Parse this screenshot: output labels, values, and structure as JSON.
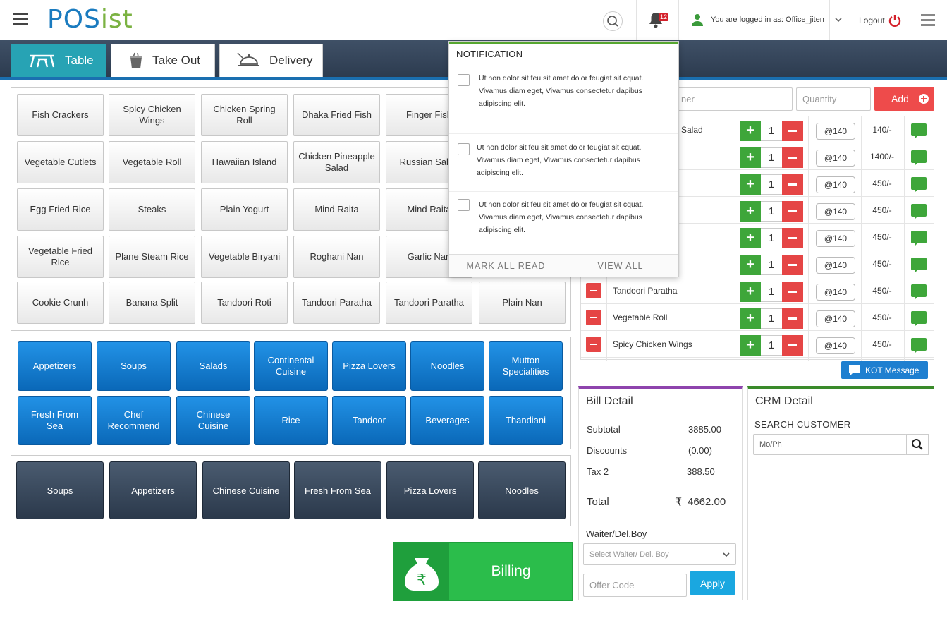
{
  "header": {
    "logo_left": "POS",
    "logo_right": "ist",
    "notification_count": "12",
    "logged_in_text": "You are logged in as: Office_jiten",
    "logout_label": "Logout"
  },
  "tabs": [
    {
      "label": "Table"
    },
    {
      "label": "Take Out"
    },
    {
      "label": "Delivery"
    }
  ],
  "items": [
    "Fish Crackers",
    "Spicy Chicken Wings",
    "Chicken Spring Roll",
    "Dhaka Fried Fish",
    "Finger Fish",
    "Vegetable Cutlets",
    "Vegetable Roll",
    "Hawaiian Island",
    "Chicken Pineapple Salad",
    "Russian Salad",
    "Egg Fried Rice",
    "Steaks",
    "Plain Yogurt",
    "Mind Raita",
    "Mind Raita",
    "Vegetable Fried Rice",
    "Plane Steam Rice",
    "Vegetable Biryani",
    "Roghani Nan",
    "Garlic Nan",
    "Cookie Crunh",
    "Banana Split",
    "Tandoori Roti",
    "Tandoori Paratha",
    "Tandoori Paratha",
    "Plain Nan"
  ],
  "categories": [
    "Appetizers",
    "Soups",
    "Salads",
    "Continental Cuisine",
    "Pizza Lovers",
    "Noodles",
    "Mutton Specialities",
    "Fresh From Sea",
    "Chef Recommend",
    "Chinese Cuisine",
    "Rice",
    "Tandoor",
    "Beverages",
    "Thandiani"
  ],
  "quick_categories": [
    "Soups",
    "Appetizers",
    "Chinese Cuisine",
    "Fresh From Sea",
    "Pizza Lovers",
    "Noodles"
  ],
  "billing_label": "Billing",
  "notification": {
    "title": "NOTIFICATION",
    "messages": [
      "Ut non dolor sit feu sit amet dolor feugiat sit cquat. Vivamus diam eget, Vivamus consectetur dapibus adipiscing elit.",
      "Ut non dolor sit feu sit amet dolor feugiat sit cquat. Vivamus diam eget, Vivamus consectetur dapibus adipiscing elit.",
      "Ut non dolor sit feu sit amet dolor feugiat sit cquat. Vivamus diam eget, Vivamus consectetur dapibus adipiscing elit."
    ],
    "mark_all_read": "MARK ALL READ",
    "view_all": "VIEW ALL"
  },
  "order_entry": {
    "item_placeholder_visible": "ner",
    "quantity_placeholder": "Quantity",
    "add_label": "Add"
  },
  "order_rows": [
    {
      "name": "e Salad",
      "qty": "1",
      "rate": "@140",
      "price": "140/-",
      "partial": true
    },
    {
      "name": "",
      "qty": "1",
      "rate": "@140",
      "price": "1400/-",
      "partial": true
    },
    {
      "name": "",
      "qty": "1",
      "rate": "@140",
      "price": "450/-",
      "partial": true
    },
    {
      "name": "",
      "qty": "1",
      "rate": "@140",
      "price": "450/-",
      "partial": true
    },
    {
      "name": "",
      "qty": "1",
      "rate": "@140",
      "price": "450/-",
      "partial": true
    },
    {
      "name": "",
      "qty": "1",
      "rate": "@140",
      "price": "450/-",
      "partial": true
    },
    {
      "name": "Tandoori Paratha",
      "qty": "1",
      "rate": "@140",
      "price": "450/-",
      "partial": false
    },
    {
      "name": "Vegetable Roll",
      "qty": "1",
      "rate": "@140",
      "price": "450/-",
      "partial": false
    },
    {
      "name": "Spicy Chicken Wings",
      "qty": "1",
      "rate": "@140",
      "price": "450/-",
      "partial": false
    }
  ],
  "kot_label": "KOT Message",
  "bill": {
    "title": "Bill Detail",
    "subtotal_label": "Subtotal",
    "subtotal": "3885.00",
    "discounts_label": "Discounts",
    "discounts": "(0.00)",
    "tax_label": "Tax 2",
    "tax": "388.50",
    "total_label": "Total",
    "currency": "₹",
    "total": "4662.00",
    "waiter_label": "Waiter/Del.Boy",
    "waiter_placeholder": "Select Waiter/ Del. Boy",
    "offer_placeholder": "Offer Code",
    "apply_label": "Apply"
  },
  "crm": {
    "title": "CRM Detail",
    "search_label": "SEARCH CUSTOMER",
    "search_placeholder": "Mo/Ph"
  },
  "colors": {
    "brand_blue": "#1a7bbf",
    "brand_green": "#7bb242",
    "active_tab": "#27a3b4",
    "billing_green": "#2bbd4b",
    "danger_red": "#e54545"
  }
}
